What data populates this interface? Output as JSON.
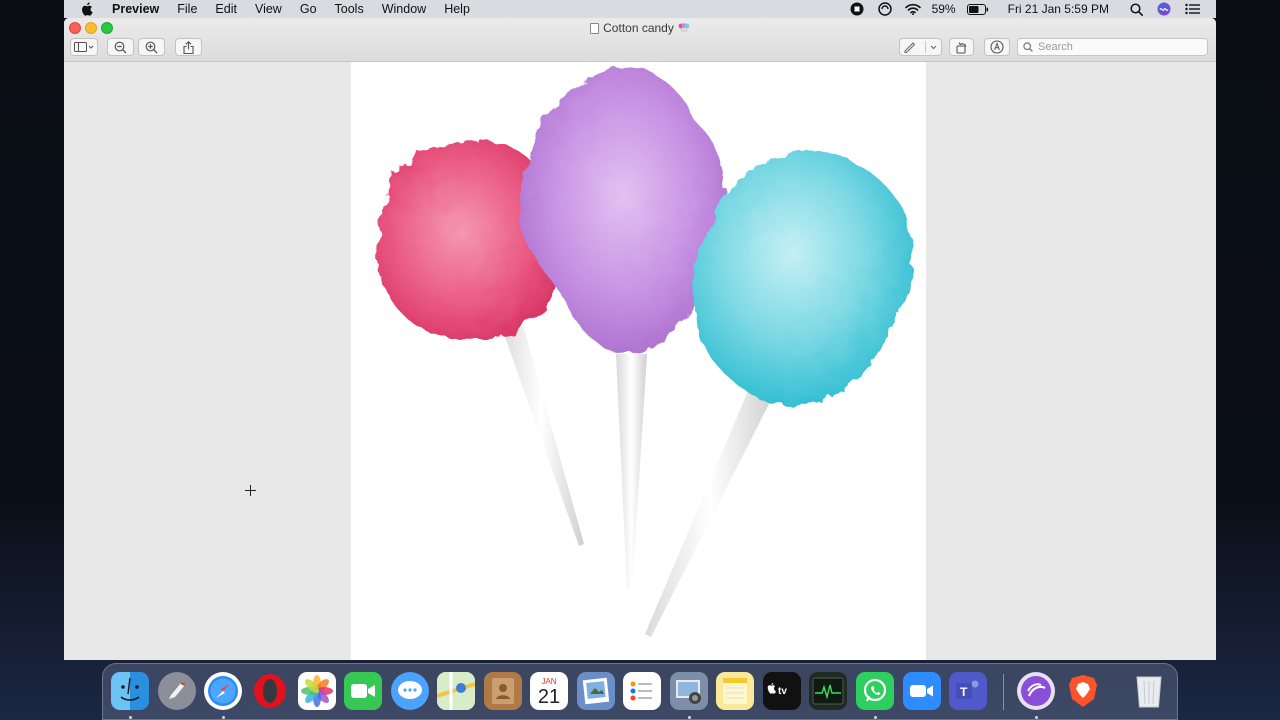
{
  "menubar": {
    "app_name": "Preview",
    "items": [
      {
        "label": "File"
      },
      {
        "label": "Edit"
      },
      {
        "label": "View"
      },
      {
        "label": "Go"
      },
      {
        "label": "Tools"
      },
      {
        "label": "Window"
      },
      {
        "label": "Help"
      }
    ],
    "status": {
      "battery_percent": "59%",
      "datetime": "Fri 21 Jan  5:59 PM"
    }
  },
  "window": {
    "title": "Cotton candy"
  },
  "toolbar": {
    "search_placeholder": "Search"
  },
  "dock": {
    "calendar": {
      "month": "JAN",
      "day": "21"
    },
    "items": [
      {
        "icon": "finder-icon"
      },
      {
        "icon": "launchpad-icon"
      },
      {
        "icon": "safari-icon"
      },
      {
        "icon": "opera-icon"
      },
      {
        "icon": "photos-icon"
      },
      {
        "icon": "facetime-icon"
      },
      {
        "icon": "messages-icon"
      },
      {
        "icon": "maps-icon"
      },
      {
        "icon": "contacts-icon"
      },
      {
        "icon": "calendar-icon"
      },
      {
        "icon": "preview-icon"
      },
      {
        "icon": "reminders-icon"
      },
      {
        "icon": "image-capture-icon"
      },
      {
        "icon": "notes-icon"
      },
      {
        "icon": "apple-tv-icon"
      },
      {
        "icon": "activity-monitor-icon"
      },
      {
        "icon": "whatsapp-icon"
      },
      {
        "icon": "zoom-icon"
      },
      {
        "icon": "teams-icon"
      },
      {
        "icon": "bittorrent-icon"
      },
      {
        "icon": "brave-icon"
      },
      {
        "icon": "trash-icon"
      }
    ]
  },
  "colors": {
    "close": "#fe5f57",
    "minimize": "#febc2e",
    "maximize": "#28c840",
    "pink_candy": "#e8507a",
    "purple_candy": "#c48ae0",
    "blue_candy": "#6ad6e0"
  }
}
